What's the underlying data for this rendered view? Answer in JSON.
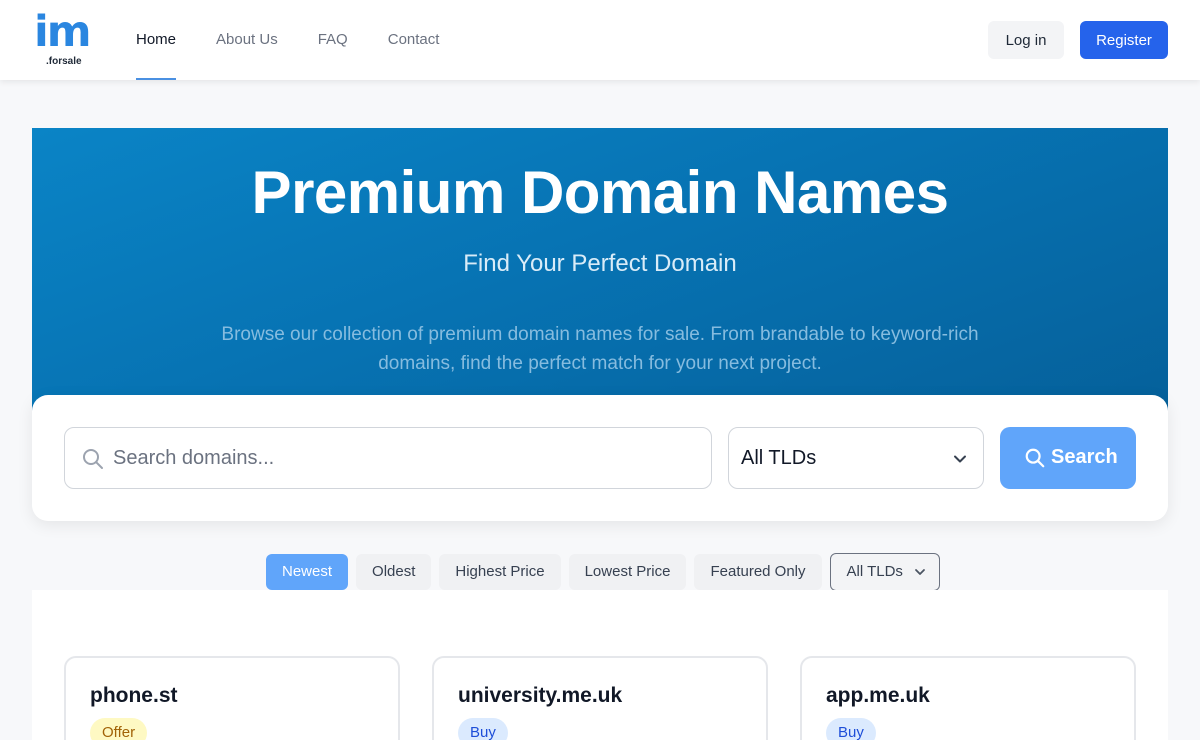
{
  "brand": {
    "logo_text": "im",
    "logo_sub": ".forsale"
  },
  "nav": {
    "items": [
      {
        "label": "Home",
        "active": true
      },
      {
        "label": "About Us",
        "active": false
      },
      {
        "label": "FAQ",
        "active": false
      },
      {
        "label": "Contact",
        "active": false
      }
    ],
    "login_label": "Log in",
    "register_label": "Register"
  },
  "hero": {
    "title": "Premium Domain Names",
    "subtitle": "Find Your Perfect Domain",
    "description": "Browse our collection of premium domain names for sale. From brandable to keyword-rich domains, find the perfect match for your next project."
  },
  "search": {
    "placeholder": "Search domains...",
    "value": "",
    "tld_selected": "All TLDs",
    "button_label": "Search"
  },
  "filters": {
    "chips": [
      {
        "label": "Newest",
        "active": true
      },
      {
        "label": "Oldest",
        "active": false
      },
      {
        "label": "Highest Price",
        "active": false
      },
      {
        "label": "Lowest Price",
        "active": false
      },
      {
        "label": "Featured Only",
        "active": false
      }
    ],
    "tld_dropdown": "All TLDs"
  },
  "domains": [
    {
      "name": "phone.st",
      "badge": "Offer",
      "badge_type": "offer"
    },
    {
      "name": "university.me.uk",
      "badge": "Buy",
      "badge_type": "buy"
    },
    {
      "name": "app.me.uk",
      "badge": "Buy",
      "badge_type": "buy"
    }
  ],
  "colors": {
    "brand_blue": "#2563eb",
    "logo_blue": "#2a86e0",
    "hero_gradient_start": "#0a84c6",
    "hero_gradient_end": "#05609a",
    "accent_light_blue": "#60a5fa"
  },
  "icons": {
    "search": "search-icon",
    "chevron": "chevron-down-icon"
  }
}
